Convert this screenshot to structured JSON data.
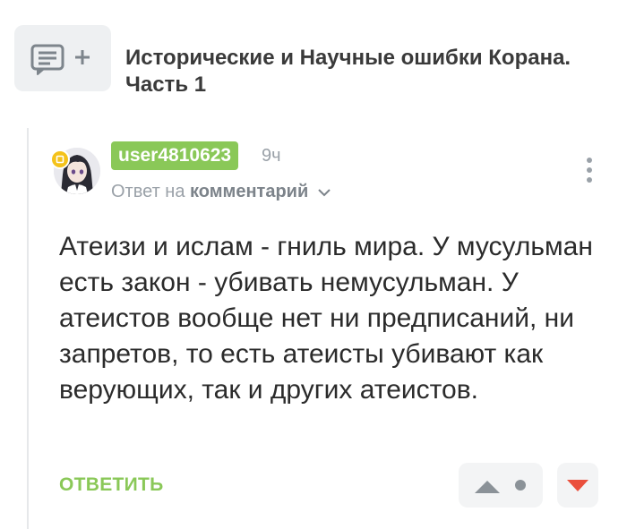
{
  "post": {
    "title": "Исторические и Научные ошибки Корана. Часть 1",
    "icon": "comment-add-icon"
  },
  "comment": {
    "username": "user4810623",
    "time": "9ч",
    "reply_prefix": "Ответ на",
    "reply_target": "комментарий",
    "text": "Атеизи и ислам - гниль мира. У мусульман есть закон - убивать немусульман. У атеистов вообще нет ни предписаний, ни запретов, то есть атеисты убивают как верующих, так и других атеистов.",
    "reply_label": "ОТВЕТИТЬ"
  },
  "colors": {
    "accent_green": "#8ac858",
    "downvote_red": "#ea4f3c",
    "muted_grey": "#9aa1a8",
    "badge_yellow": "#f4c21a"
  }
}
